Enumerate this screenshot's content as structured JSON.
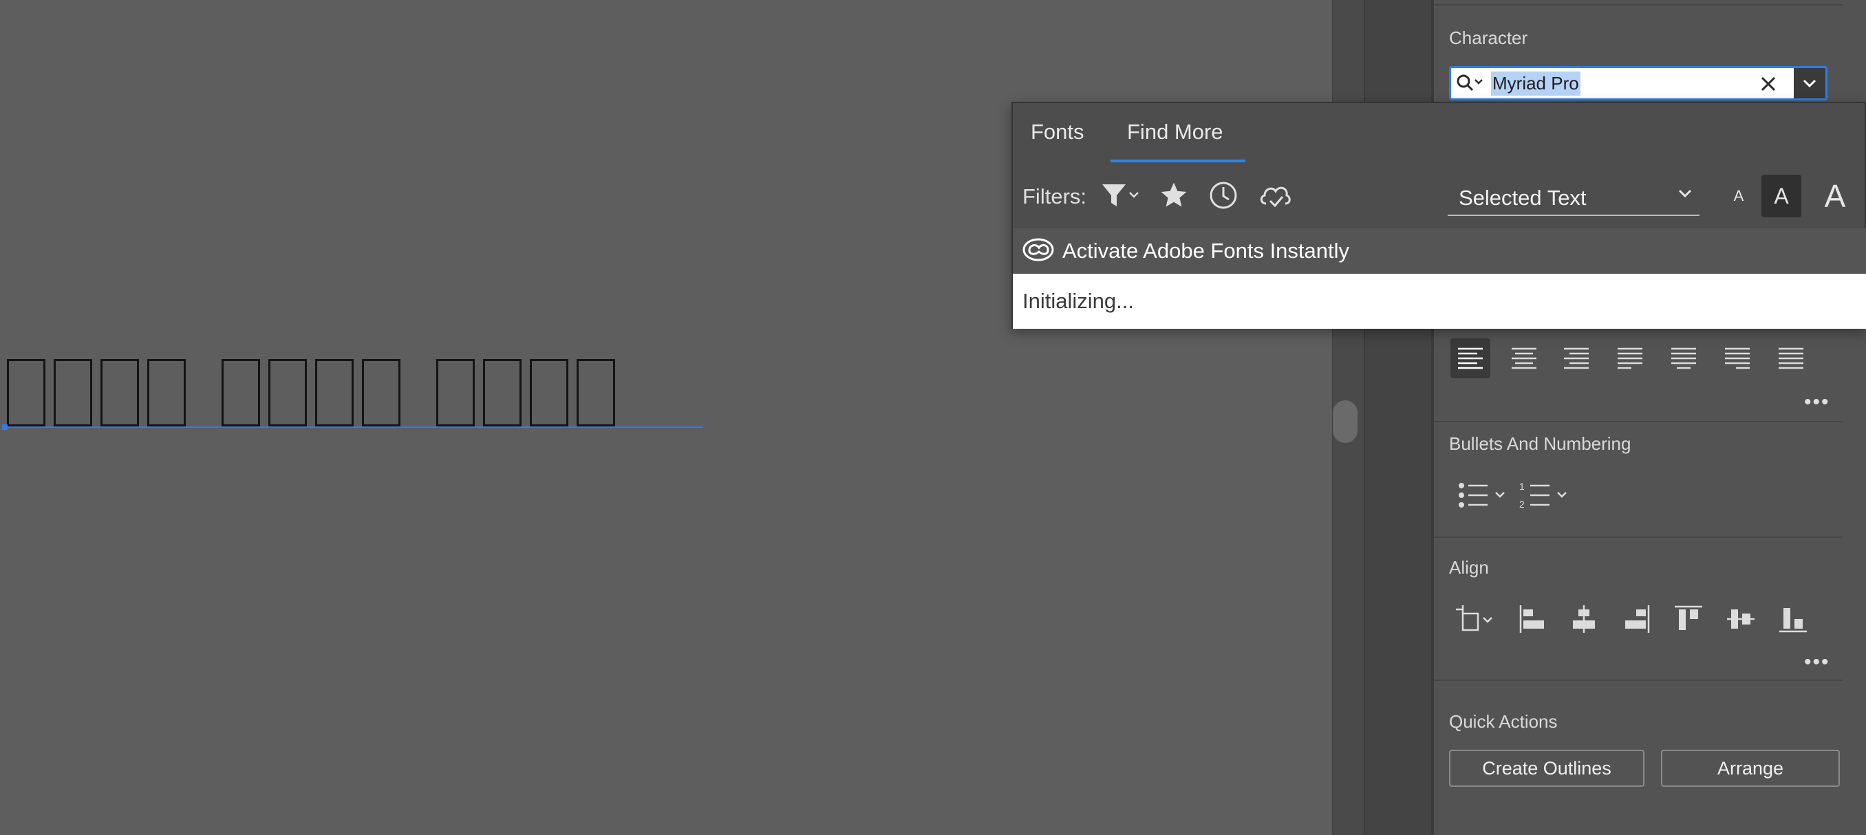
{
  "canvas": {
    "word_glyph_counts": [
      4,
      4,
      4
    ],
    "accent_color": "#3a78e6"
  },
  "properties_panel": {
    "character": {
      "title": "Character",
      "font_family": "Myriad Pro"
    },
    "paragraph": {
      "align_buttons": [
        "align-left",
        "align-center",
        "align-right",
        "justify-last-left",
        "justify-last-center",
        "justify-last-right",
        "justify-all"
      ],
      "active_align": "align-left",
      "more_label": "•••"
    },
    "bullets": {
      "title": "Bullets And Numbering"
    },
    "align": {
      "title": "Align",
      "more_label": "•••"
    },
    "quick_actions": {
      "title": "Quick Actions",
      "create_outlines": "Create Outlines",
      "arrange": "Arrange"
    }
  },
  "font_popup": {
    "tabs": [
      {
        "label": "Fonts",
        "active": false
      },
      {
        "label": "Find More",
        "active": true
      }
    ],
    "filters_label": "Filters:",
    "filter_icons": [
      "filter-icon",
      "star-icon",
      "clock-icon",
      "cloud-check-icon"
    ],
    "preview_mode": "Selected Text",
    "size_labels": [
      "A",
      "A",
      "A"
    ],
    "activate_label": "Activate Adobe Fonts Instantly",
    "status_text": "Initializing...",
    "accent_color": "#2e86e6"
  }
}
